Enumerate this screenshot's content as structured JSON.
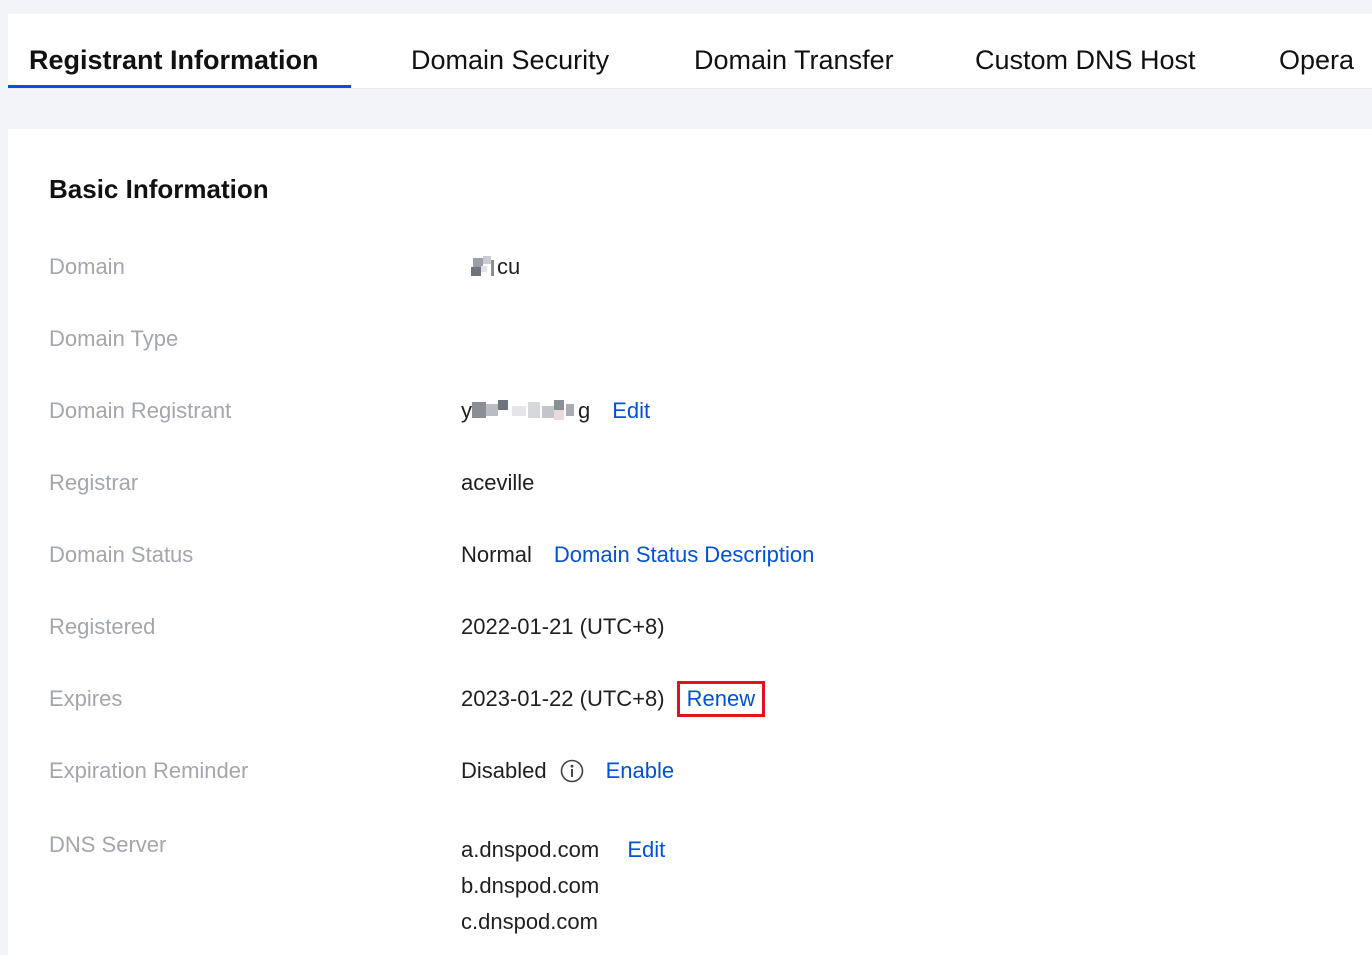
{
  "tabs": [
    {
      "label": "Registrant Information",
      "active": true
    },
    {
      "label": "Domain Security",
      "active": false
    },
    {
      "label": "Domain Transfer",
      "active": false
    },
    {
      "label": "Custom DNS Host",
      "active": false
    },
    {
      "label": "Opera",
      "active": false
    }
  ],
  "basic_info": {
    "title": "Basic Information",
    "domain": {
      "label": "Domain",
      "value_suffix": "cu"
    },
    "domain_type": {
      "label": "Domain Type",
      "value": ""
    },
    "domain_registrant": {
      "label": "Domain Registrant",
      "value_prefix": "y",
      "value_suffix": "g",
      "edit_label": "Edit"
    },
    "registrar": {
      "label": "Registrar",
      "value": "aceville"
    },
    "domain_status": {
      "label": "Domain Status",
      "value": "Normal",
      "link_label": "Domain Status Description"
    },
    "registered": {
      "label": "Registered",
      "value": "2022-01-21 (UTC+8)"
    },
    "expires": {
      "label": "Expires",
      "value": "2023-01-22 (UTC+8)",
      "renew_label": "Renew"
    },
    "expiration_reminder": {
      "label": "Expiration Reminder",
      "value": "Disabled",
      "icon": "info-icon",
      "enable_label": "Enable"
    },
    "dns_server": {
      "label": "DNS Server",
      "servers": [
        "a.dnspod.com",
        "b.dnspod.com",
        "c.dnspod.com"
      ],
      "edit_label": "Edit"
    }
  },
  "colors": {
    "accent": "#0052d9",
    "highlight_border": "#e3101e",
    "label": "#a2a6ad"
  }
}
